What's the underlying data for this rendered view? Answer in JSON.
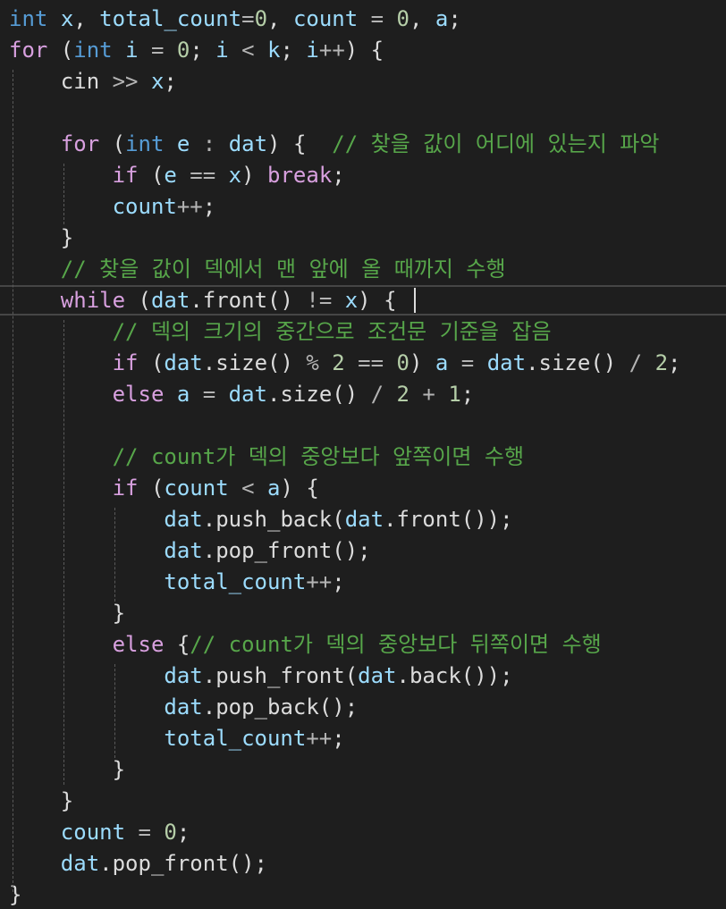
{
  "colors": {
    "background": "#1e1e1e",
    "keyword": "#569cd6",
    "control": "#d8a0df",
    "variable": "#9cdcfe",
    "number": "#b5cea8",
    "comment": "#57a64a",
    "plain": "#dcdcdc",
    "function": "#dcdcaa"
  },
  "editor": {
    "lines": [
      [
        [
          "kw",
          "int"
        ],
        [
          "pl",
          " "
        ],
        [
          "var",
          "x"
        ],
        [
          "pun",
          ", "
        ],
        [
          "var",
          "total_count"
        ],
        [
          "op",
          "="
        ],
        [
          "num",
          "0"
        ],
        [
          "pun",
          ", "
        ],
        [
          "var",
          "count"
        ],
        [
          "op",
          " = "
        ],
        [
          "num",
          "0"
        ],
        [
          "pun",
          ", "
        ],
        [
          "var",
          "a"
        ],
        [
          "pun",
          ";"
        ]
      ],
      [
        [
          "ctl",
          "for"
        ],
        [
          "pun",
          " ("
        ],
        [
          "kw",
          "int"
        ],
        [
          "pl",
          " "
        ],
        [
          "var",
          "i"
        ],
        [
          "op",
          " = "
        ],
        [
          "num",
          "0"
        ],
        [
          "pun",
          "; "
        ],
        [
          "var",
          "i"
        ],
        [
          "op",
          " < "
        ],
        [
          "var",
          "k"
        ],
        [
          "pun",
          "; "
        ],
        [
          "var",
          "i"
        ],
        [
          "op",
          "++"
        ],
        [
          "pun",
          ") {"
        ]
      ],
      [
        [
          "pl",
          "    "
        ],
        [
          "pl",
          "cin"
        ],
        [
          "op",
          " >> "
        ],
        [
          "var",
          "x"
        ],
        [
          "pun",
          ";"
        ]
      ],
      [],
      [
        [
          "pl",
          "    "
        ],
        [
          "ctl",
          "for"
        ],
        [
          "pun",
          " ("
        ],
        [
          "kw",
          "int"
        ],
        [
          "pl",
          " "
        ],
        [
          "var",
          "e"
        ],
        [
          "op",
          " : "
        ],
        [
          "var",
          "dat"
        ],
        [
          "pun",
          ") {  "
        ],
        [
          "cmt",
          "// 찾을 값이 어디에 있는지 파악"
        ]
      ],
      [
        [
          "pl",
          "        "
        ],
        [
          "ctl",
          "if"
        ],
        [
          "pun",
          " ("
        ],
        [
          "var",
          "e"
        ],
        [
          "op",
          " == "
        ],
        [
          "var",
          "x"
        ],
        [
          "pun",
          ") "
        ],
        [
          "ctl",
          "break"
        ],
        [
          "pun",
          ";"
        ]
      ],
      [
        [
          "pl",
          "        "
        ],
        [
          "var",
          "count"
        ],
        [
          "op",
          "++"
        ],
        [
          "pun",
          ";"
        ]
      ],
      [
        [
          "pl",
          "    "
        ],
        [
          "pun",
          "}"
        ]
      ],
      [
        [
          "pl",
          "    "
        ],
        [
          "cmt",
          "// 찾을 값이 덱에서 맨 앞에 올 때까지 수행"
        ]
      ],
      [
        [
          "pl",
          "    "
        ],
        [
          "ctl",
          "while"
        ],
        [
          "pun",
          " ("
        ],
        [
          "var",
          "dat"
        ],
        [
          "pun",
          "."
        ],
        [
          "pl",
          "front"
        ],
        [
          "pun",
          "()"
        ],
        [
          "op",
          " != "
        ],
        [
          "var",
          "x"
        ],
        [
          "pun",
          ") {"
        ]
      ],
      [
        [
          "pl",
          "        "
        ],
        [
          "cmt",
          "// 덱의 크기의 중간으로 조건문 기준을 잡음"
        ]
      ],
      [
        [
          "pl",
          "        "
        ],
        [
          "ctl",
          "if"
        ],
        [
          "pun",
          " ("
        ],
        [
          "var",
          "dat"
        ],
        [
          "pun",
          "."
        ],
        [
          "pl",
          "size"
        ],
        [
          "pun",
          "()"
        ],
        [
          "op",
          " % "
        ],
        [
          "num",
          "2"
        ],
        [
          "op",
          " == "
        ],
        [
          "num",
          "0"
        ],
        [
          "pun",
          ") "
        ],
        [
          "var",
          "a"
        ],
        [
          "op",
          " = "
        ],
        [
          "var",
          "dat"
        ],
        [
          "pun",
          "."
        ],
        [
          "pl",
          "size"
        ],
        [
          "pun",
          "()"
        ],
        [
          "op",
          " / "
        ],
        [
          "num",
          "2"
        ],
        [
          "pun",
          ";"
        ]
      ],
      [
        [
          "pl",
          "        "
        ],
        [
          "ctl",
          "else"
        ],
        [
          "pl",
          " "
        ],
        [
          "var",
          "a"
        ],
        [
          "op",
          " = "
        ],
        [
          "var",
          "dat"
        ],
        [
          "pun",
          "."
        ],
        [
          "pl",
          "size"
        ],
        [
          "pun",
          "()"
        ],
        [
          "op",
          " / "
        ],
        [
          "num",
          "2"
        ],
        [
          "op",
          " + "
        ],
        [
          "num",
          "1"
        ],
        [
          "pun",
          ";"
        ]
      ],
      [],
      [
        [
          "pl",
          "        "
        ],
        [
          "cmt",
          "// count가 덱의 중앙보다 앞쪽이면 수행"
        ]
      ],
      [
        [
          "pl",
          "        "
        ],
        [
          "ctl",
          "if"
        ],
        [
          "pun",
          " ("
        ],
        [
          "var",
          "count"
        ],
        [
          "op",
          " < "
        ],
        [
          "var",
          "a"
        ],
        [
          "pun",
          ") {"
        ]
      ],
      [
        [
          "pl",
          "            "
        ],
        [
          "var",
          "dat"
        ],
        [
          "pun",
          "."
        ],
        [
          "pl",
          "push_back"
        ],
        [
          "pun",
          "("
        ],
        [
          "var",
          "dat"
        ],
        [
          "pun",
          "."
        ],
        [
          "pl",
          "front"
        ],
        [
          "pun",
          "());"
        ]
      ],
      [
        [
          "pl",
          "            "
        ],
        [
          "var",
          "dat"
        ],
        [
          "pun",
          "."
        ],
        [
          "pl",
          "pop_front"
        ],
        [
          "pun",
          "();"
        ]
      ],
      [
        [
          "pl",
          "            "
        ],
        [
          "var",
          "total_count"
        ],
        [
          "op",
          "++"
        ],
        [
          "pun",
          ";"
        ]
      ],
      [
        [
          "pl",
          "        "
        ],
        [
          "pun",
          "}"
        ]
      ],
      [
        [
          "pl",
          "        "
        ],
        [
          "ctl",
          "else"
        ],
        [
          "pun",
          " {"
        ],
        [
          "cmt",
          "// count가 덱의 중앙보다 뒤쪽이면 수행"
        ]
      ],
      [
        [
          "pl",
          "            "
        ],
        [
          "var",
          "dat"
        ],
        [
          "pun",
          "."
        ],
        [
          "pl",
          "push_front"
        ],
        [
          "pun",
          "("
        ],
        [
          "var",
          "dat"
        ],
        [
          "pun",
          "."
        ],
        [
          "pl",
          "back"
        ],
        [
          "pun",
          "());"
        ]
      ],
      [
        [
          "pl",
          "            "
        ],
        [
          "var",
          "dat"
        ],
        [
          "pun",
          "."
        ],
        [
          "pl",
          "pop_back"
        ],
        [
          "pun",
          "();"
        ]
      ],
      [
        [
          "pl",
          "            "
        ],
        [
          "var",
          "total_count"
        ],
        [
          "op",
          "++"
        ],
        [
          "pun",
          ";"
        ]
      ],
      [
        [
          "pl",
          "        "
        ],
        [
          "pun",
          "}"
        ]
      ],
      [
        [
          "pl",
          "    "
        ],
        [
          "pun",
          "}"
        ]
      ],
      [
        [
          "pl",
          "    "
        ],
        [
          "var",
          "count"
        ],
        [
          "op",
          " = "
        ],
        [
          "num",
          "0"
        ],
        [
          "pun",
          ";"
        ]
      ],
      [
        [
          "pl",
          "    "
        ],
        [
          "var",
          "dat"
        ],
        [
          "pun",
          "."
        ],
        [
          "pl",
          "pop_front"
        ],
        [
          "pun",
          "();"
        ]
      ],
      [
        [
          "pun",
          "}"
        ]
      ]
    ]
  }
}
